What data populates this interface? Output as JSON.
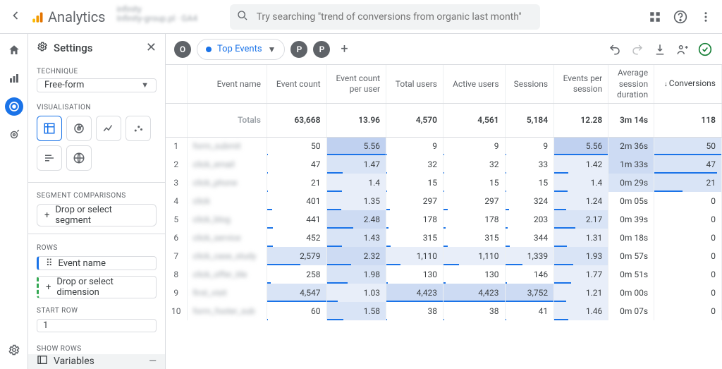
{
  "header": {
    "product": "Analytics",
    "search_placeholder": "Try searching \"trend of conversions from organic last month\""
  },
  "settings": {
    "title": "Settings",
    "technique_label": "TECHNIQUE",
    "technique_value": "Free-form",
    "visualisation_label": "VISUALISATION",
    "segment_label": "SEGMENT COMPARISONS",
    "segment_btn": "Drop or select segment",
    "rows_label": "ROWS",
    "rows_chip": "Event name",
    "rows_add": "Drop or select dimension",
    "startrow_label": "START ROW",
    "startrow_value": "1",
    "showrows_label": "SHOW ROWS",
    "variables": "Variables"
  },
  "tabs": {
    "o": "O",
    "active": "Top Events",
    "p": "P",
    "plus": "+"
  },
  "toolbar_icons": {
    "undo": "undo",
    "redo": "redo",
    "download": "download",
    "share": "share",
    "status": "ok"
  },
  "table": {
    "headers": [
      "Event name",
      "Event count",
      "Event count per user",
      "Total users",
      "Active users",
      "Sessions",
      "Events per session",
      "Average session duration",
      "Conversions"
    ],
    "totals_label": "Totals",
    "totals": [
      "63,668",
      "13.96",
      "4,570",
      "4,561",
      "5,184",
      "12.28",
      "3m 14s",
      "118"
    ],
    "rows": [
      {
        "n": 1,
        "name": "form_submit",
        "cells": [
          "50",
          "5.56",
          "9",
          "9",
          "9",
          "5.56",
          "2m 36s",
          "50"
        ]
      },
      {
        "n": 2,
        "name": "click_email",
        "cells": [
          "47",
          "1.47",
          "32",
          "32",
          "33",
          "1.42",
          "1m 33s",
          "47"
        ]
      },
      {
        "n": 3,
        "name": "click_phone",
        "cells": [
          "21",
          "1.4",
          "15",
          "15",
          "15",
          "1.4",
          "0m 29s",
          "21"
        ]
      },
      {
        "n": 4,
        "name": "click",
        "cells": [
          "401",
          "1.35",
          "297",
          "297",
          "324",
          "1.24",
          "0m 05s",
          "0"
        ]
      },
      {
        "n": 5,
        "name": "click_blog",
        "cells": [
          "441",
          "2.48",
          "178",
          "178",
          "203",
          "2.17",
          "0m 39s",
          "0"
        ]
      },
      {
        "n": 6,
        "name": "click_service",
        "cells": [
          "452",
          "1.43",
          "315",
          "315",
          "344",
          "1.31",
          "0m 18s",
          "0"
        ]
      },
      {
        "n": 7,
        "name": "click_case_study",
        "cells": [
          "2,579",
          "2.32",
          "1,110",
          "1,110",
          "1,339",
          "1.93",
          "0m 57s",
          "0"
        ]
      },
      {
        "n": 8,
        "name": "click_offer_tile",
        "cells": [
          "258",
          "1.98",
          "130",
          "130",
          "146",
          "1.77",
          "0m 51s",
          "0"
        ]
      },
      {
        "n": 9,
        "name": "first_visit",
        "cells": [
          "4,547",
          "1.03",
          "4,423",
          "4,423",
          "3,752",
          "1.21",
          "0m 00s",
          "0"
        ]
      },
      {
        "n": 10,
        "name": "form_footer_sub",
        "cells": [
          "60",
          "1.58",
          "38",
          "38",
          "41",
          "1.46",
          "0m 07s",
          "0"
        ]
      }
    ]
  }
}
